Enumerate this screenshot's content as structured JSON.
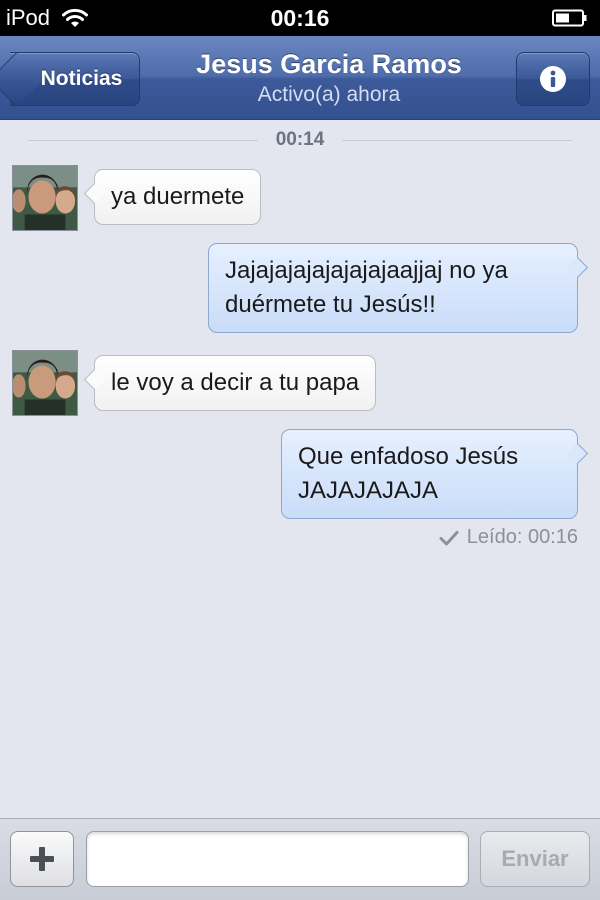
{
  "status_bar": {
    "carrier": "iPod",
    "time": "00:16",
    "icons": [
      "wifi-icon",
      "battery-icon"
    ]
  },
  "header": {
    "back_label": "Noticias",
    "contact_name": "Jesus Garcia Ramos",
    "contact_status": "Activo(a) ahora",
    "info_icon": "info-icon"
  },
  "conversation": {
    "timestamp": "00:14",
    "messages": [
      {
        "direction": "incoming",
        "text": "ya duermete"
      },
      {
        "direction": "outgoing",
        "text": "Jajajajajajajajajaajjaj no ya duérmete tu Jesús!!"
      },
      {
        "direction": "incoming",
        "text": "le voy a decir a tu papa"
      },
      {
        "direction": "outgoing",
        "text": "Que enfadoso Jesús JAJAJAJAJA"
      }
    ],
    "read_receipt": "Leído: 00:16"
  },
  "composer": {
    "input_value": "",
    "input_placeholder": "",
    "send_label": "Enviar",
    "attach_icon": "plus-icon"
  },
  "colors": {
    "nav_bar": "#4f6cab",
    "background": "#e3e6ee",
    "outgoing_bubble": "#d3e3fa",
    "incoming_bubble": "#ffffff"
  }
}
